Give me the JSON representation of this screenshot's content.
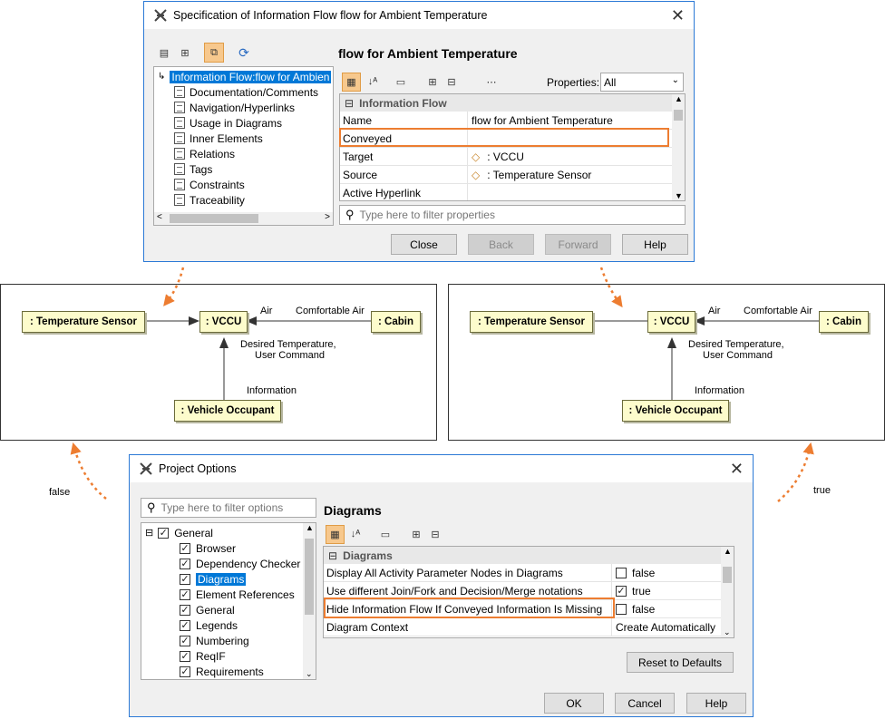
{
  "spec_window": {
    "title": "Specification of Information Flow flow for Ambient Temperature",
    "heading": "flow for Ambient Temperature",
    "tree": [
      "Information Flow:flow for Ambien",
      "Documentation/Comments",
      "Navigation/Hyperlinks",
      "Usage in Diagrams",
      "Inner Elements",
      "Relations",
      "Tags",
      "Constraints",
      "Traceability"
    ],
    "properties_label": "Properties:",
    "properties_value": "All",
    "group_header": "Information Flow",
    "rows": [
      {
        "key": "Name",
        "value": "flow for Ambient Temperature"
      },
      {
        "key": "Conveyed",
        "value": ""
      },
      {
        "key": "Target",
        "value": ": VCCU"
      },
      {
        "key": "Source",
        "value": ": Temperature Sensor"
      },
      {
        "key": "Active Hyperlink",
        "value": ""
      }
    ],
    "filter_placeholder": "Type here to filter properties",
    "buttons": {
      "close": "Close",
      "back": "Back",
      "forward": "Forward",
      "help": "Help"
    }
  },
  "diagram_left": {
    "nodes": {
      "sensor": ": Temperature Sensor",
      "vccu": ": VCCU",
      "cabin": ": Cabin",
      "occupant": ": Vehicle Occupant"
    },
    "labels": {
      "air": "Air",
      "comfortable": "Comfortable Air",
      "desired1": "Desired Temperature,",
      "desired2": "User Command",
      "information": "Information"
    }
  },
  "diagram_right": {
    "nodes": {
      "sensor": ": Temperature Sensor",
      "vccu": ": VCCU",
      "cabin": ": Cabin",
      "occupant": ": Vehicle Occupant"
    },
    "labels": {
      "air": "Air",
      "comfortable": "Comfortable Air",
      "desired1": "Desired Temperature,",
      "desired2": "User Command",
      "information": "Information"
    }
  },
  "side_labels": {
    "left": "false",
    "right": "true"
  },
  "options_window": {
    "title": "Project Options",
    "filter_placeholder": "Type here to filter options",
    "heading": "Diagrams",
    "tree": [
      {
        "label": "General",
        "level": 0
      },
      {
        "label": "Browser",
        "level": 1
      },
      {
        "label": "Dependency Checker",
        "level": 1
      },
      {
        "label": "Diagrams",
        "level": 1
      },
      {
        "label": "Element References",
        "level": 1
      },
      {
        "label": "General",
        "level": 1
      },
      {
        "label": "Legends",
        "level": 1
      },
      {
        "label": "Numbering",
        "level": 1
      },
      {
        "label": "ReqIF",
        "level": 1
      },
      {
        "label": "Requirements",
        "level": 1
      }
    ],
    "group_header": "Diagrams",
    "rows": [
      {
        "key": "Display All Activity Parameter Nodes in Diagrams",
        "checked": false,
        "value": "false"
      },
      {
        "key": "Use different Join/Fork and Decision/Merge notations",
        "checked": true,
        "value": "true"
      },
      {
        "key": "Hide Information Flow If Conveyed Information Is Missing",
        "checked": false,
        "value": "false"
      },
      {
        "key": "Diagram Context",
        "checked": null,
        "value": "Create Automatically"
      }
    ],
    "buttons": {
      "reset": "Reset to Defaults",
      "ok": "OK",
      "cancel": "Cancel",
      "help": "Help"
    }
  },
  "colors": {
    "highlight": "#ed7d31",
    "selection": "#0078d7",
    "node_fill": "#fdfccc"
  }
}
